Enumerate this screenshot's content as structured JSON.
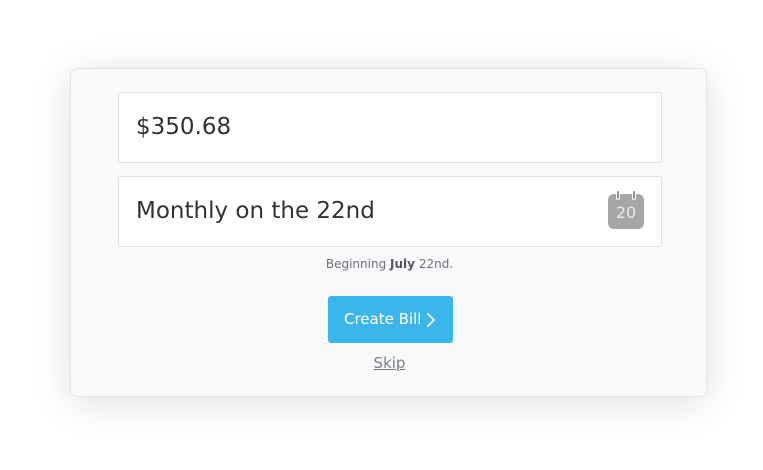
{
  "bill": {
    "amount_value": "$350.68",
    "schedule_value": "Monthly on the 22nd",
    "calendar_day": "20"
  },
  "hint": {
    "prefix": "Beginning",
    "month": "July",
    "day_suffix": "22nd."
  },
  "actions": {
    "create_label": "Create Bill",
    "create_icon": "chevron-right-icon",
    "skip_label": "Skip"
  },
  "colors": {
    "button": "#3cb6ea",
    "calendar_icon": "#a6a6a6"
  }
}
